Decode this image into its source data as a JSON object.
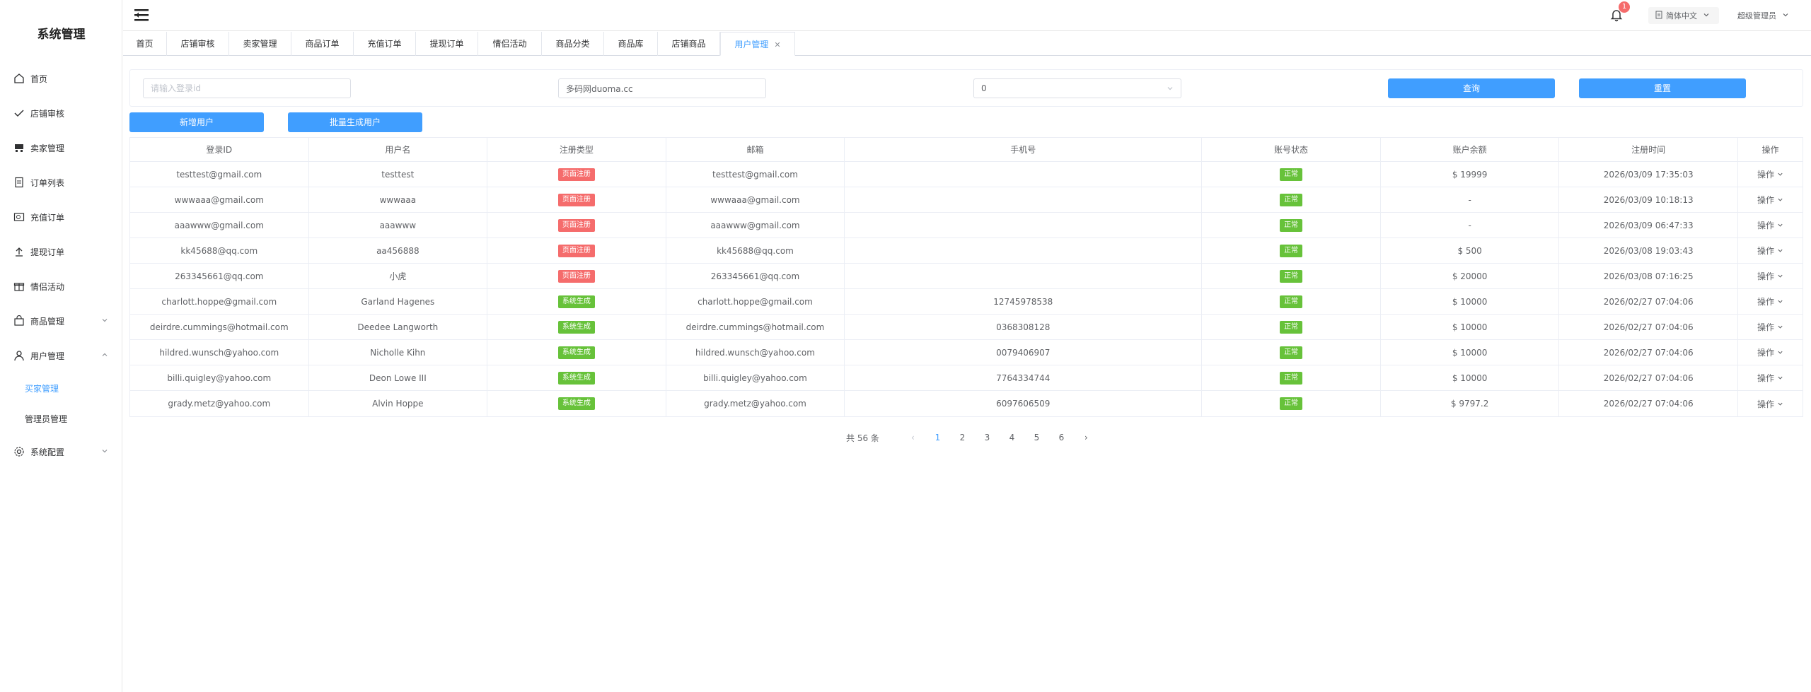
{
  "app": {
    "title": "系统管理"
  },
  "sidebar": {
    "items": [
      {
        "label": "首页",
        "icon": "home-icon"
      },
      {
        "label": "店铺审核",
        "icon": "check-icon"
      },
      {
        "label": "卖家管理",
        "icon": "seller-icon"
      },
      {
        "label": "订单列表",
        "icon": "document-icon"
      },
      {
        "label": "充值订单",
        "icon": "recharge-icon"
      },
      {
        "label": "提现订单",
        "icon": "upload-icon"
      },
      {
        "label": "情侣活动",
        "icon": "gift-icon"
      },
      {
        "label": "商品管理",
        "icon": "shop-bag-icon",
        "expandable": true
      },
      {
        "label": "用户管理",
        "icon": "user-icon",
        "expanded": true
      }
    ],
    "sub_items": [
      {
        "label": "买家管理",
        "active": true
      },
      {
        "label": "管理员管理"
      }
    ],
    "last_item": {
      "label": "系统配置",
      "icon": "gear-icon"
    }
  },
  "header": {
    "notification_count": "1",
    "language": "简体中文",
    "user": "超级管理员"
  },
  "tabs": [
    {
      "label": "首页"
    },
    {
      "label": "店铺审核"
    },
    {
      "label": "卖家管理"
    },
    {
      "label": "商品订单"
    },
    {
      "label": "充值订单"
    },
    {
      "label": "提现订单"
    },
    {
      "label": "情侣活动"
    },
    {
      "label": "商品分类"
    },
    {
      "label": "商品库"
    },
    {
      "label": "店铺商品"
    },
    {
      "label": "用户管理",
      "active": true,
      "closable": true
    }
  ],
  "filters": {
    "login_id_placeholder": "请输入登录id",
    "site_value": "多码网duoma.cc",
    "select_value": "0",
    "query_label": "查询",
    "reset_label": "重置"
  },
  "actions": {
    "add_user": "新增用户",
    "batch_generate": "批量生成用户"
  },
  "table": {
    "columns": [
      "登录ID",
      "用户名",
      "注册类型",
      "邮箱",
      "手机号",
      "账号状态",
      "账户余额",
      "注册时间",
      "操作"
    ],
    "rows": [
      {
        "login_id": "testtest@gmail.com",
        "username": "testtest",
        "reg_type": "页面注册",
        "reg_kind": "page",
        "email": "testtest@gmail.com",
        "phone": "",
        "status": "正常",
        "balance": "$ 19999",
        "reg_time": "2026/03/09 17:35:03",
        "op": "操作"
      },
      {
        "login_id": "wwwaaa@gmail.com",
        "username": "wwwaaa",
        "reg_type": "页面注册",
        "reg_kind": "page",
        "email": "wwwaaa@gmail.com",
        "phone": "",
        "status": "正常",
        "balance": "-",
        "reg_time": "2026/03/09 10:18:13",
        "op": "操作"
      },
      {
        "login_id": "aaawww@gmail.com",
        "username": "aaawww",
        "reg_type": "页面注册",
        "reg_kind": "page",
        "email": "aaawww@gmail.com",
        "phone": "",
        "status": "正常",
        "balance": "-",
        "reg_time": "2026/03/09 06:47:33",
        "op": "操作"
      },
      {
        "login_id": "kk45688@qq.com",
        "username": "aa456888",
        "reg_type": "页面注册",
        "reg_kind": "page",
        "email": "kk45688@qq.com",
        "phone": "",
        "status": "正常",
        "balance": "$ 500",
        "reg_time": "2026/03/08 19:03:43",
        "op": "操作"
      },
      {
        "login_id": "263345661@qq.com",
        "username": "小虎",
        "reg_type": "页面注册",
        "reg_kind": "page",
        "email": "263345661@qq.com",
        "phone": "",
        "status": "正常",
        "balance": "$ 20000",
        "reg_time": "2026/03/08 07:16:25",
        "op": "操作"
      },
      {
        "login_id": "charlott.hoppe@gmail.com",
        "username": "Garland Hagenes",
        "reg_type": "系统生成",
        "reg_kind": "system",
        "email": "charlott.hoppe@gmail.com",
        "phone": "12745978538",
        "status": "正常",
        "balance": "$ 10000",
        "reg_time": "2026/02/27 07:04:06",
        "op": "操作"
      },
      {
        "login_id": "deirdre.cummings@hotmail.com",
        "username": "Deedee Langworth",
        "reg_type": "系统生成",
        "reg_kind": "system",
        "email": "deirdre.cummings@hotmail.com",
        "phone": "0368308128",
        "status": "正常",
        "balance": "$ 10000",
        "reg_time": "2026/02/27 07:04:06",
        "op": "操作"
      },
      {
        "login_id": "hildred.wunsch@yahoo.com",
        "username": "Nicholle Kihn",
        "reg_type": "系统生成",
        "reg_kind": "system",
        "email": "hildred.wunsch@yahoo.com",
        "phone": "0079406907",
        "status": "正常",
        "balance": "$ 10000",
        "reg_time": "2026/02/27 07:04:06",
        "op": "操作"
      },
      {
        "login_id": "billi.quigley@yahoo.com",
        "username": "Deon Lowe III",
        "reg_type": "系统生成",
        "reg_kind": "system",
        "email": "billi.quigley@yahoo.com",
        "phone": "7764334744",
        "status": "正常",
        "balance": "$ 10000",
        "reg_time": "2026/02/27 07:04:06",
        "op": "操作"
      },
      {
        "login_id": "grady.metz@yahoo.com",
        "username": "Alvin Hoppe",
        "reg_type": "系统生成",
        "reg_kind": "system",
        "email": "grady.metz@yahoo.com",
        "phone": "6097606509",
        "status": "正常",
        "balance": "$ 9797.2",
        "reg_time": "2026/02/27 07:04:06",
        "op": "操作"
      }
    ]
  },
  "pagination": {
    "total": "共 56 条",
    "pages": [
      "1",
      "2",
      "3",
      "4",
      "5",
      "6"
    ],
    "current": "1"
  },
  "colors": {
    "primary": "#409eff",
    "danger": "#f56c6c",
    "success": "#67c23a"
  }
}
